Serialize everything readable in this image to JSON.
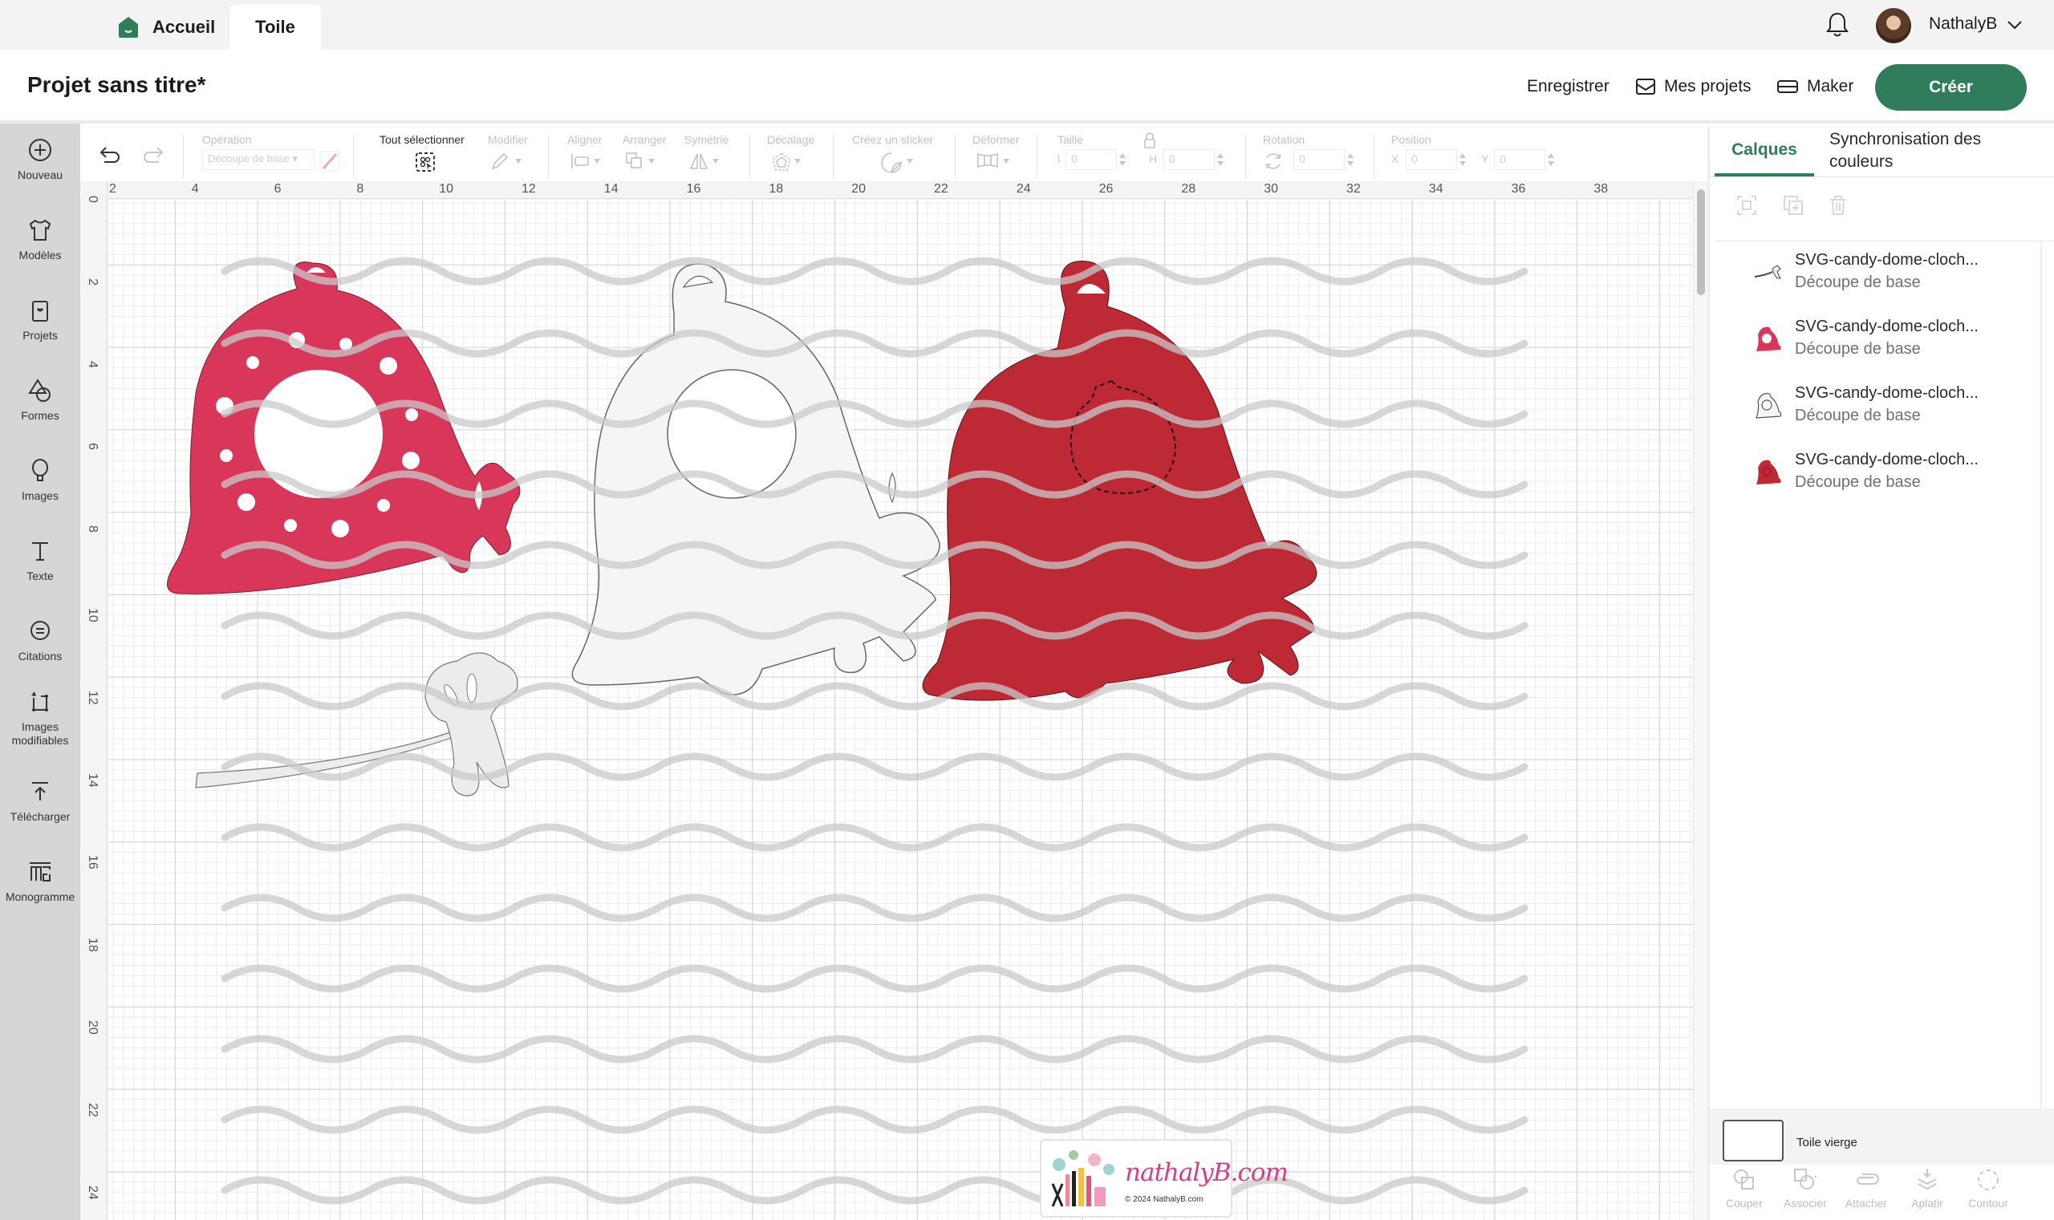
{
  "topbar": {
    "home_tab": "Accueil",
    "canvas_tab": "Toile",
    "user_name": "NathalyB"
  },
  "header": {
    "project_title": "Projet sans titre*",
    "save_label": "Enregistrer",
    "my_projects_label": "Mes projets",
    "maker_label": "Maker",
    "create_label": "Créer"
  },
  "colors": {
    "accent": "#2f7d5a",
    "bell_pink": "#d8375a",
    "bell_red": "#bd2a36",
    "bell_white": "#f5f5f5",
    "watermark_pink": "#d63f82"
  },
  "sidebar": {
    "items": [
      {
        "label": "Nouveau",
        "icon": "plus-circle-icon"
      },
      {
        "label": "Modèles",
        "icon": "tshirt-icon"
      },
      {
        "label": "Projets",
        "icon": "projects-icon"
      },
      {
        "label": "Formes",
        "icon": "shapes-icon"
      },
      {
        "label": "Images",
        "icon": "balloon-icon"
      },
      {
        "label": "Texte",
        "icon": "text-icon"
      },
      {
        "label": "Citations",
        "icon": "quote-bubble-icon"
      },
      {
        "label": "Images modifiables",
        "icon": "editable-image-icon"
      },
      {
        "label": "Télécharger",
        "icon": "upload-icon"
      },
      {
        "label": "Monogramme",
        "icon": "monogram-icon"
      }
    ]
  },
  "toolbar": {
    "operation_label": "Opération",
    "operation_value": "Découpe de base",
    "select_all_label": "Tout sélectionner",
    "modify_label": "Modifier",
    "align_label": "Aligner",
    "arrange_label": "Arranger",
    "symmetry_label": "Symétrie",
    "offset_label": "Décalage",
    "sticker_label": "Créez un sticker",
    "warp_label": "Déformer",
    "size_label": "Taille",
    "width_axis": "l",
    "height_axis": "H",
    "width_value": "0",
    "height_value": "0",
    "rotation_label": "Rotation",
    "rotation_value": "0",
    "position_label": "Position",
    "x_axis": "X",
    "y_axis": "Y",
    "x_value": "0",
    "y_value": "0"
  },
  "canvas": {
    "ruler_top": [
      "2",
      "4",
      "6",
      "8",
      "10",
      "12",
      "14",
      "16",
      "18",
      "20",
      "22",
      "24",
      "26",
      "28",
      "30",
      "32",
      "34",
      "36",
      "38"
    ],
    "ruler_left": [
      "0",
      "2",
      "4",
      "6",
      "8",
      "10",
      "12",
      "14",
      "16",
      "18",
      "20",
      "22",
      "24"
    ],
    "watermark_brand": "nathalyB.com",
    "watermark_copyright": "© 2024 NathalyB.com"
  },
  "right_panel": {
    "tab_layers": "Calques",
    "tab_color_sync": "Synchronisation des couleurs",
    "layers": [
      {
        "name": "SVG-candy-dome-cloch...",
        "operation": "Découpe de base",
        "thumb": "ribbon"
      },
      {
        "name": "SVG-candy-dome-cloch...",
        "operation": "Découpe de base",
        "thumb": "pink-bell"
      },
      {
        "name": "SVG-candy-dome-cloch...",
        "operation": "Découpe de base",
        "thumb": "white-bell"
      },
      {
        "name": "SVG-candy-dome-cloch...",
        "operation": "Découpe de base",
        "thumb": "red-bell"
      }
    ],
    "blank_canvas_label": "Toile vierge",
    "bottom_actions": [
      "Couper",
      "Associer",
      "Attacher",
      "Aplatir",
      "Contour"
    ]
  }
}
